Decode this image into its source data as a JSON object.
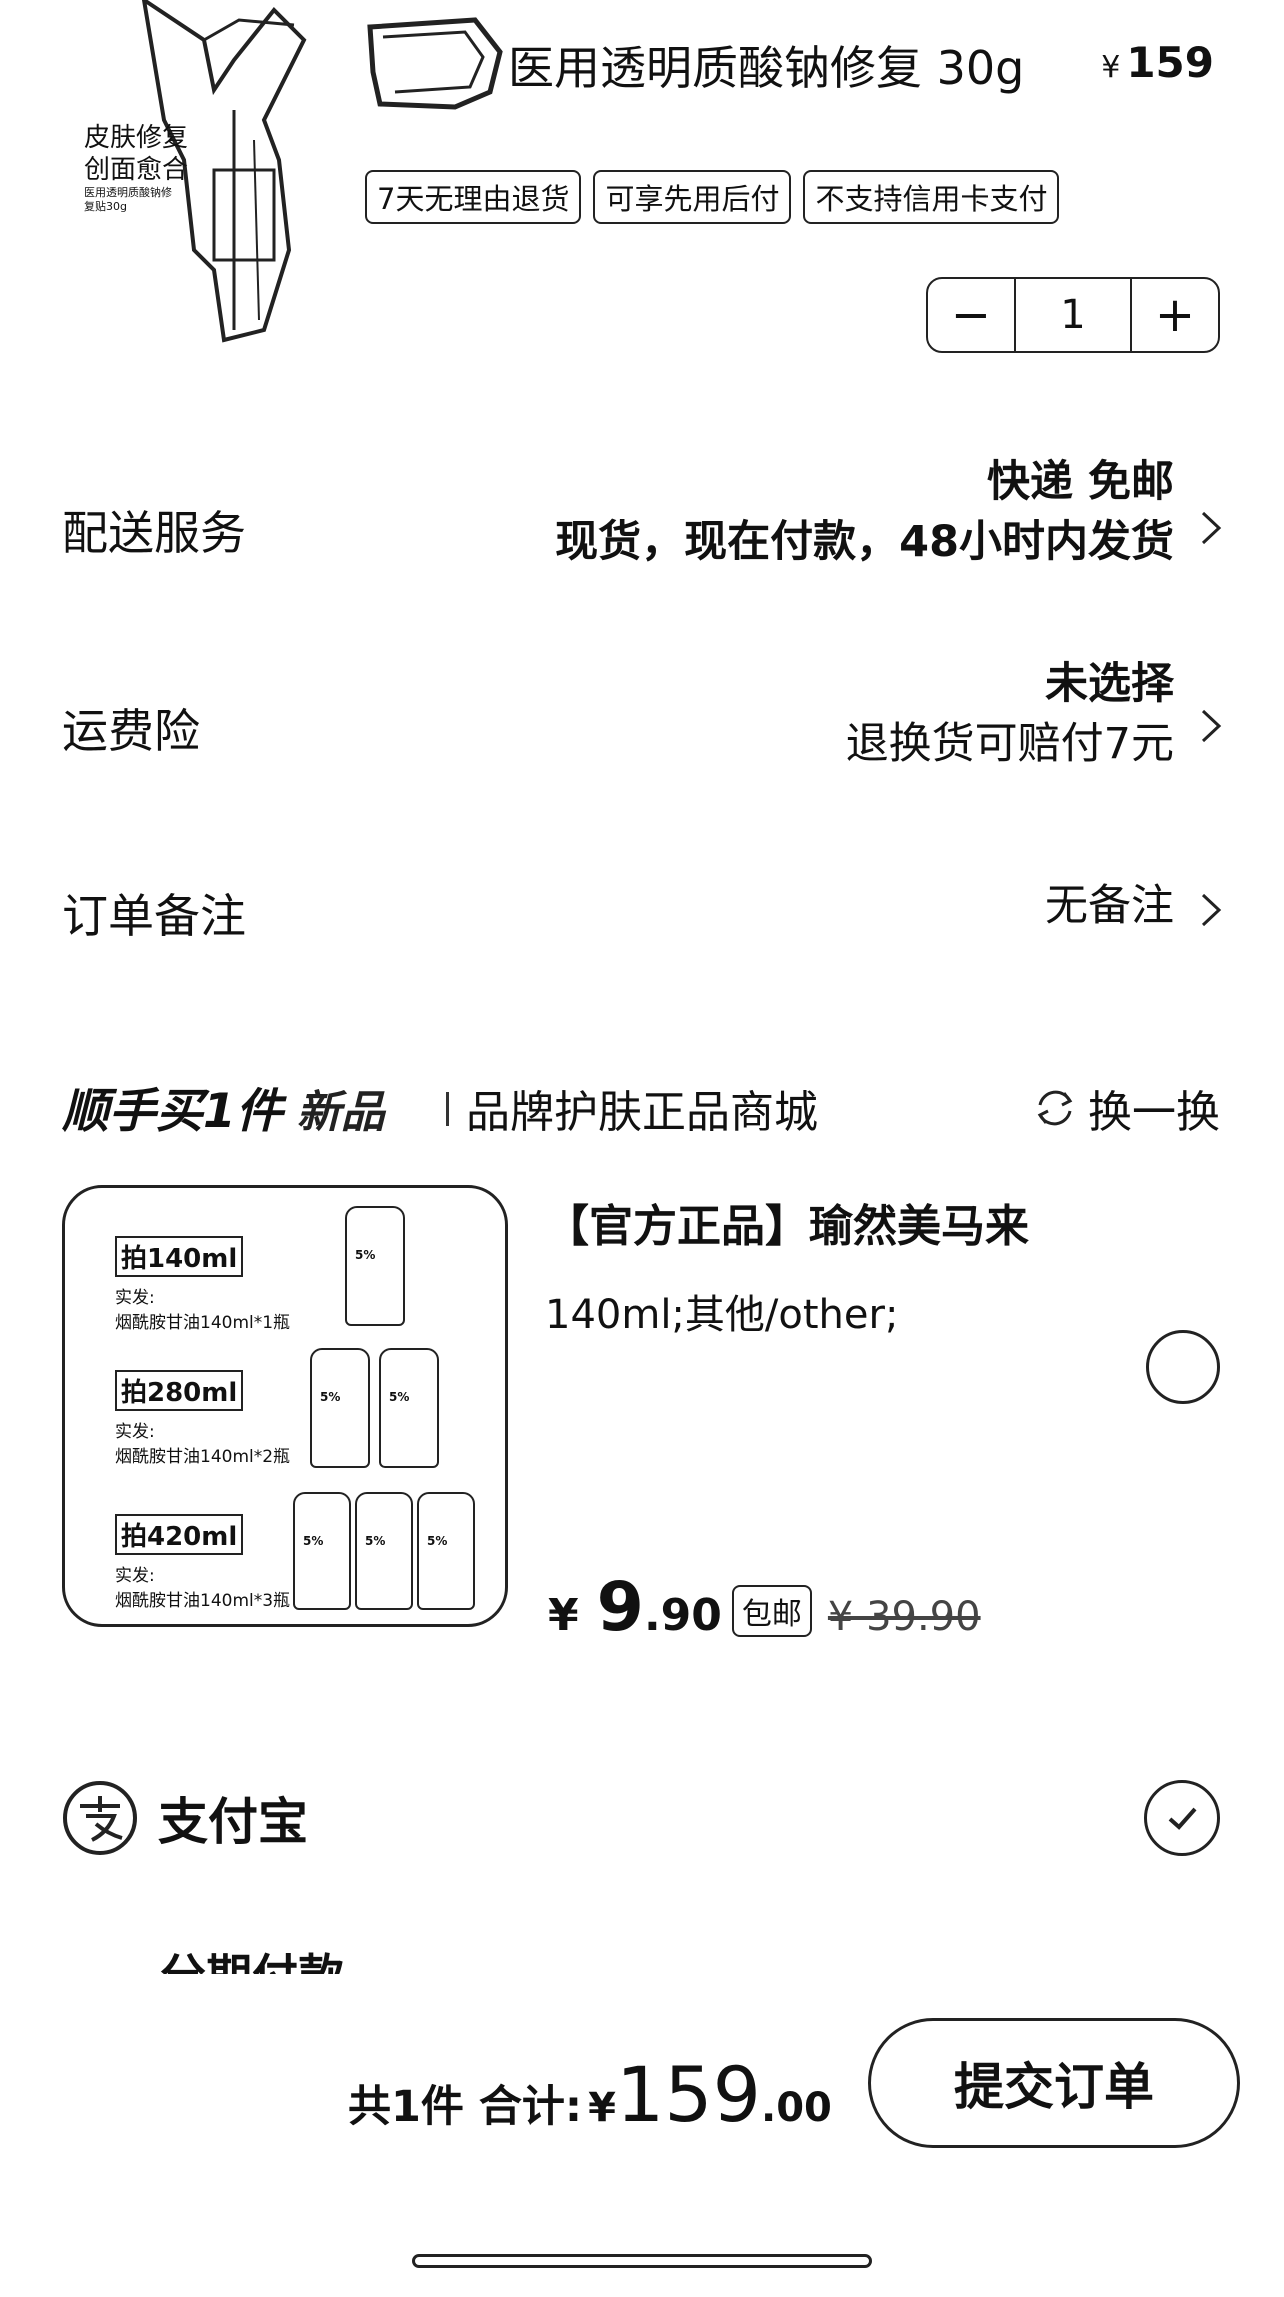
{
  "product": {
    "image_caption_line1": "皮肤修复",
    "image_caption_line2": "创面愈合",
    "image_caption_small": "医用透明质酸钠修复贴30g",
    "title": "医用透明质酸钠修复 30g",
    "price_symbol": "¥",
    "price": "159",
    "tags": [
      "7天无理由退货",
      "可享先用后付",
      "不支持信用卡支付"
    ],
    "quantity": "1",
    "minus_label": "−",
    "plus_label": "+"
  },
  "delivery": {
    "label": "配送服务",
    "method": "快递 免邮",
    "detail": "现货，现在付款，48小时内发货"
  },
  "shipping_insurance": {
    "label": "运费险",
    "status": "未选择",
    "detail": "退换货可赔付7元"
  },
  "order_note": {
    "label": "订单备注",
    "value": "无备注"
  },
  "recommend": {
    "title": "顺手买1件",
    "new_label": "新品",
    "brand_text": "品牌护肤正品商城",
    "refresh_label": "换一换",
    "item": {
      "name": "【官方正品】瑜然美马来",
      "spec": "140ml;其他/other;",
      "price_symbol": "¥",
      "price_int": "9",
      "price_dec": ".90",
      "shipping_tag": "包邮",
      "original_price": "¥ 39.90",
      "image_labels": [
        {
          "tag": "拍140ml",
          "line1": "实发:",
          "line2": "烟酰胺甘油140ml*1瓶"
        },
        {
          "tag": "拍280ml",
          "line1": "实发:",
          "line2": "烟酰胺甘油140ml*2瓶"
        },
        {
          "tag": "拍420ml",
          "line1": "实发:",
          "line2": "烟酰胺甘油140ml*3瓶"
        }
      ],
      "bottle_label": "5%"
    }
  },
  "payment": {
    "method": "支付宝",
    "partial_next": "分期付款"
  },
  "footer": {
    "count_label": "共1件 合计:",
    "total_symbol": "¥",
    "total_int": "159",
    "total_dec": ".00",
    "submit_label": "提交订单"
  }
}
